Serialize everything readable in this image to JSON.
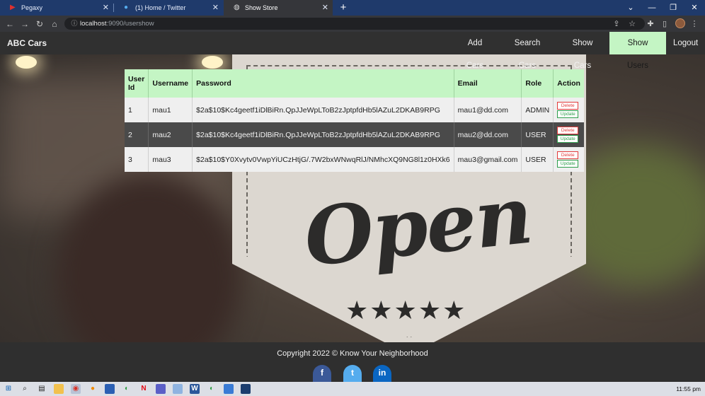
{
  "browser": {
    "tabs": [
      {
        "title": "Pegaxy",
        "icon": "pegaxy-icon",
        "active": false
      },
      {
        "title": "(1) Home / Twitter",
        "icon": "twitter-icon",
        "active": false
      },
      {
        "title": "Show Store",
        "icon": "globe-icon",
        "active": true
      }
    ],
    "url_host": "localhost",
    "url_path": ":9090/usershow"
  },
  "navbar": {
    "brand": "ABC Cars",
    "links": [
      {
        "label": "Add Cars",
        "active": false
      },
      {
        "label": "Search Cars",
        "active": false
      },
      {
        "label": "Show Cars",
        "active": false
      },
      {
        "label": "Show Users",
        "active": true
      },
      {
        "label": "Logout",
        "active": false
      }
    ]
  },
  "users_table": {
    "headers": [
      "User Id",
      "Username",
      "Password",
      "Email",
      "Role",
      "Action"
    ],
    "rows": [
      {
        "id": "1",
        "username": "mau1",
        "password": "$2a$10$Kc4geetf1iDlBiRn.QpJJeWpLToB2zJptpfdHb5lAZuL2DKAB9RPG",
        "email": "mau1@dd.com",
        "role": "ADMIN"
      },
      {
        "id": "2",
        "username": "mau2",
        "password": "$2a$10$Kc4geetf1iDlBiRn.QpJJeWpLToB2zJptpfdHb5lAZuL2DKAB9RPG",
        "email": "mau2@dd.com",
        "role": "USER"
      },
      {
        "id": "3",
        "username": "mau3",
        "password": "$2a$10$Y0Xvytv0VwpYiUCzHtjG/.7W2bxWNwqRlJ/NMhcXQ9NG8l1z0HXk6",
        "email": "mau3@gmail.com",
        "role": "USER"
      }
    ],
    "delete_label": "Delete",
    "update_label": "Update"
  },
  "background": {
    "sign_text": "Open",
    "stars": "★★★★★"
  },
  "footer": {
    "copyright": "Copyright 2022 © Know Your Neighborhood",
    "social": [
      "facebook-icon",
      "twitter-icon",
      "linkedin-icon"
    ]
  },
  "taskbar": {
    "clock": "11:55 pm"
  },
  "colors": {
    "accent_green": "#c4f5c4",
    "navbar_bg": "#303030",
    "delete_red": "#e23b3b",
    "update_green": "#2e9e4b"
  }
}
